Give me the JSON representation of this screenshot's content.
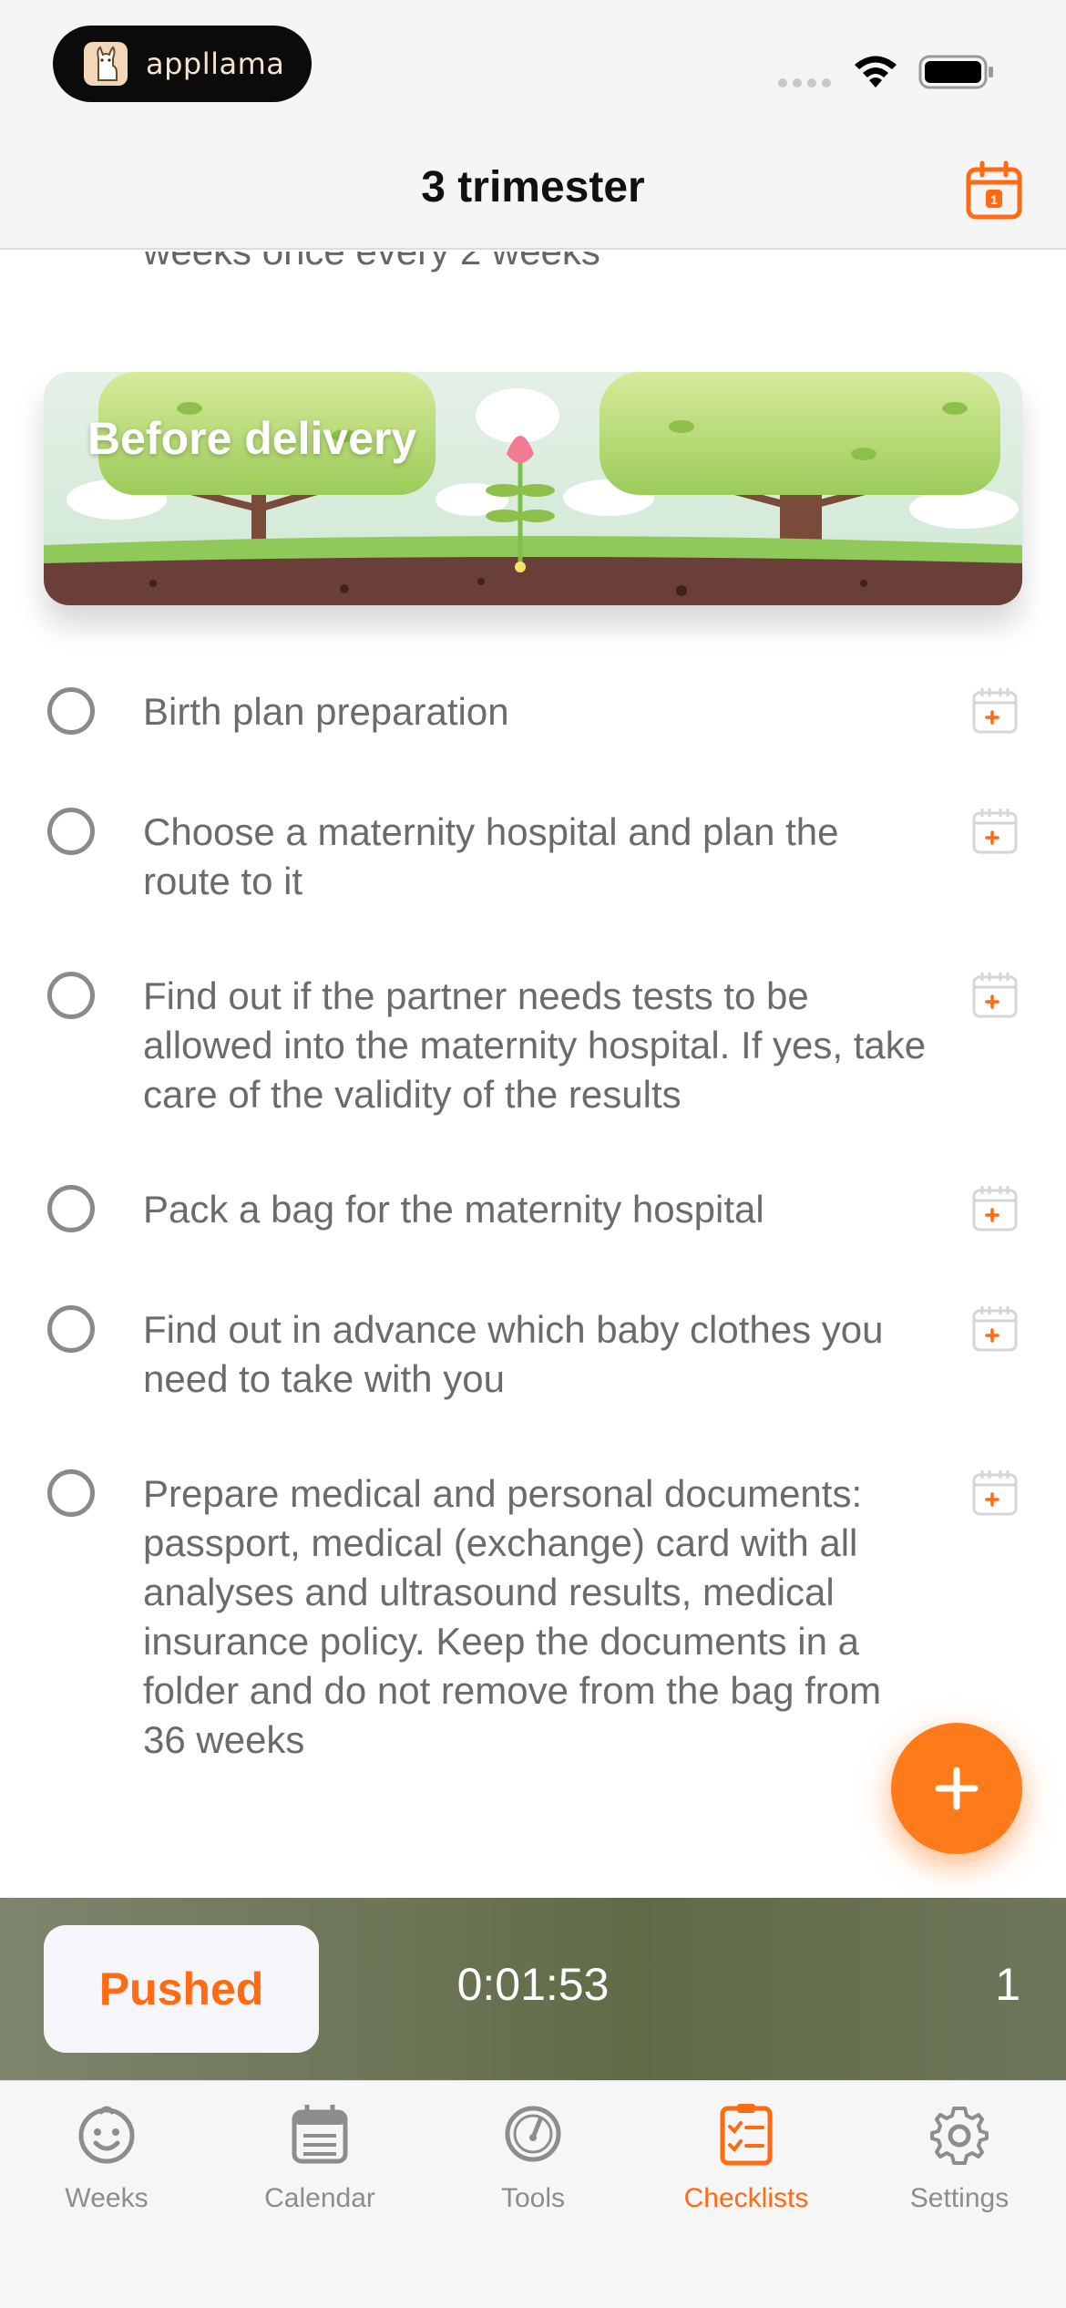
{
  "status_bar": {
    "brand": "appllama"
  },
  "nav": {
    "title": "3 trimester"
  },
  "content": {
    "previous_item_tail": "weeks once every 2 weeks",
    "section": {
      "title": "Before delivery"
    },
    "tasks": [
      {
        "text": "Birth plan preparation"
      },
      {
        "text": "Choose a maternity hospital and plan the route to it"
      },
      {
        "text": "Find out if the partner needs tests to be allowed into the maternity hospital. If yes, take care of the validity of the results"
      },
      {
        "text": "Pack a bag for the maternity hospital"
      },
      {
        "text": "Find out in advance which baby clothes you need to take with you"
      },
      {
        "text": "Prepare medical and personal documents: passport, medical (exchange) card with all analyses and ultrasound results, medical insurance policy. Keep the documents in a folder and do not remove from the bag from 36 weeks"
      }
    ]
  },
  "timer_bar": {
    "pushed_label": "Pushed",
    "elapsed": "0:01:53",
    "count": "1"
  },
  "tabs": [
    {
      "label": "Weeks",
      "icon": "baby-face-icon",
      "active": false
    },
    {
      "label": "Calendar",
      "icon": "calendar-icon",
      "active": false
    },
    {
      "label": "Tools",
      "icon": "gauge-icon",
      "active": false
    },
    {
      "label": "Checklists",
      "icon": "checklist-icon",
      "active": true
    },
    {
      "label": "Settings",
      "icon": "gear-icon",
      "active": false
    }
  ],
  "colors": {
    "accent": "#ff6a13",
    "timer_bg": "#6b7455",
    "inactive": "#8d8d8d"
  }
}
